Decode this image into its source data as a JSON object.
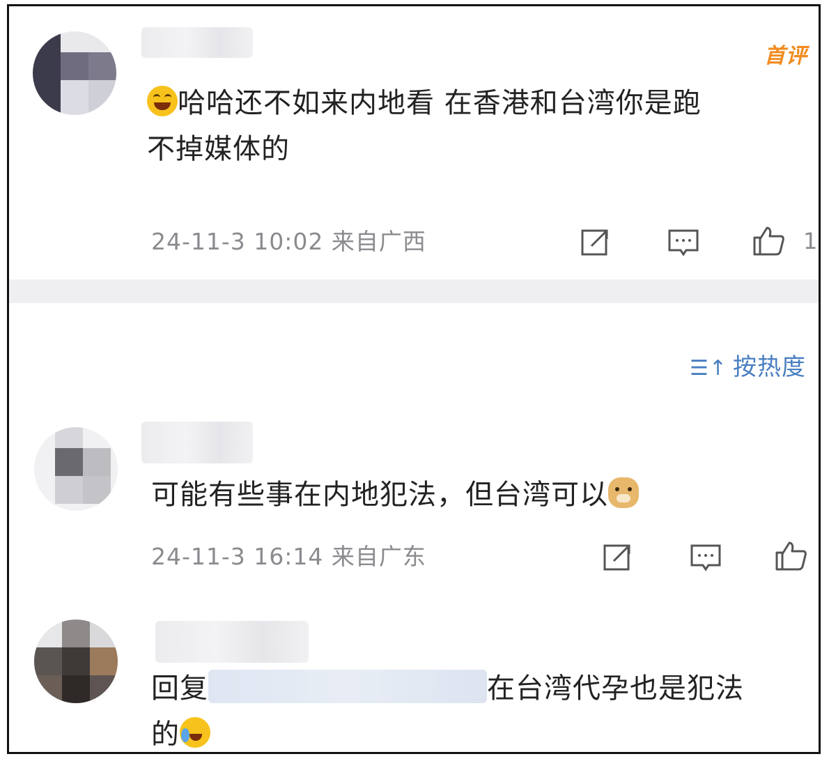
{
  "comments": [
    {
      "badge": "首评",
      "text_main": "哈哈还不如来内地看 在香港和台湾你是跑",
      "text_wrap": "不掉媒体的",
      "emoji": "laughing-face",
      "time": "24-11-3 10:02",
      "location": "来自广西",
      "like_count": "1"
    },
    {
      "text_main": "可能有些事在内地犯法，但台湾可以",
      "emoji": "doge",
      "time": "24-11-3 16:14",
      "location": "来自广东"
    },
    {
      "reply_prefix": "回复",
      "text_main": "在台湾代孕也是犯法",
      "text_wrap": "的",
      "emoji": "crying-laughing-face"
    }
  ],
  "sort": {
    "label": "按热度",
    "icon": "sort-icon"
  },
  "icons": [
    "share-icon",
    "comment-icon",
    "like-icon"
  ],
  "colors": {
    "badge": "#f28b20",
    "sort_accent": "#4a7fc1",
    "meta_gray": "#8a8a8f",
    "divider": "#efeff1"
  }
}
